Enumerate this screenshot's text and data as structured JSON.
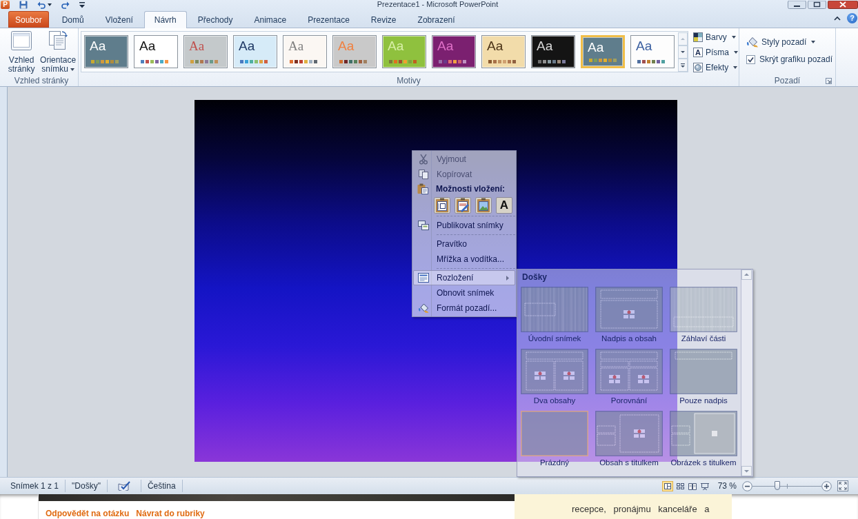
{
  "title_bar": {
    "logo": "P",
    "title": "Prezentace1 - Microsoft PowerPoint"
  },
  "tabs": [
    {
      "label": "Soubor",
      "kind": "file",
      "selected": false
    },
    {
      "label": "Domů",
      "kind": "tab",
      "selected": false
    },
    {
      "label": "Vložení",
      "kind": "tab",
      "selected": false
    },
    {
      "label": "Návrh",
      "kind": "tab",
      "selected": true
    },
    {
      "label": "Přechody",
      "kind": "tab",
      "selected": false
    },
    {
      "label": "Animace",
      "kind": "tab",
      "selected": false
    },
    {
      "label": "Prezentace",
      "kind": "tab",
      "selected": false
    },
    {
      "label": "Revize",
      "kind": "tab",
      "selected": false
    },
    {
      "label": "Zobrazení",
      "kind": "tab",
      "selected": false
    }
  ],
  "help": "?",
  "ribbon": {
    "groups": [
      {
        "kind": "page_setup",
        "label": "Vzhled stránky",
        "buttons": [
          {
            "kind": "page",
            "label": "Vzhled stránky",
            "dropdown": false
          },
          {
            "kind": "orientation",
            "label": "Orientace snímku",
            "dropdown": true
          }
        ]
      },
      {
        "kind": "themes",
        "label": "Motivy",
        "themes": [
          {
            "sample": "Aa",
            "color": "#5f7d8c",
            "selected": false
          },
          {
            "sample": "Aa",
            "color": "#ffffff",
            "selected": false
          },
          {
            "sample": "Aa",
            "color": "#c4c9cb",
            "selected": false
          },
          {
            "sample": "Aa",
            "color": "#d6ebf8",
            "selected": false
          },
          {
            "sample": "Aa",
            "color": "#fbf7f3",
            "selected": false
          },
          {
            "sample": "Aa",
            "color": "#c9c9c9",
            "selected": false
          },
          {
            "sample": "Aa",
            "color": "#8fc13e",
            "selected": false
          },
          {
            "sample": "Aa",
            "color": "#7b2070",
            "selected": false
          },
          {
            "sample": "Aa",
            "color": "#f2dcaa",
            "selected": false
          },
          {
            "sample": "Aa",
            "color": "#141414",
            "selected": false
          },
          {
            "sample": "Aa",
            "color": "#5f7d8c",
            "selected": true
          },
          {
            "sample": "Aa",
            "color": "#fdfdfd",
            "selected": false
          }
        ],
        "commands": [
          {
            "kind": "colors",
            "label": "Barvy",
            "dropdown": true
          },
          {
            "kind": "fonts",
            "glyph": "A",
            "label": "Písma",
            "dropdown": true
          },
          {
            "kind": "effects",
            "label": "Efekty",
            "dropdown": true
          }
        ]
      },
      {
        "kind": "background",
        "label": "Pozadí",
        "styles": {
          "label": "Styly pozadí",
          "dropdown": true
        },
        "hide_graphics": {
          "label": "Skrýt grafiku pozadí",
          "checked": true
        }
      }
    ]
  },
  "context_menu": {
    "items": [
      {
        "kind": "item",
        "label": "Vyjmout",
        "disabled": true,
        "selected": false
      },
      {
        "kind": "item",
        "label": "Kopírovat",
        "disabled": true,
        "selected": false
      },
      {
        "kind": "header",
        "label": "Možnosti vložení:"
      },
      {
        "kind": "paste_options",
        "options": [
          {
            "kind": "destination"
          },
          {
            "kind": "source"
          },
          {
            "kind": "picture"
          },
          {
            "kind": "text",
            "glyph": "A"
          }
        ]
      },
      {
        "kind": "separator"
      },
      {
        "kind": "item",
        "label": "Publikovat snímky",
        "disabled": false,
        "selected": false
      },
      {
        "kind": "separator"
      },
      {
        "kind": "item",
        "label": "Pravítko",
        "disabled": false,
        "selected": false
      },
      {
        "kind": "item",
        "label": "Mřížka a vodítka...",
        "disabled": false,
        "selected": false
      },
      {
        "kind": "separator"
      },
      {
        "kind": "submenu",
        "label": "Rozložení",
        "disabled": false,
        "selected": true
      },
      {
        "kind": "item",
        "label": "Obnovit snímek",
        "disabled": false,
        "selected": false
      },
      {
        "kind": "item",
        "label": "Formát pozadí...",
        "disabled": false,
        "selected": false
      }
    ]
  },
  "layout_gallery": {
    "title": "Došky",
    "layouts": [
      {
        "kind": "title",
        "label": "Úvodní snímek",
        "selected": false
      },
      {
        "kind": "title_content",
        "label": "Nadpis a obsah",
        "selected": false
      },
      {
        "kind": "section",
        "label": "Záhlaví části",
        "selected": false
      },
      {
        "kind": "two_content",
        "label": "Dva obsahy",
        "selected": false
      },
      {
        "kind": "comparison",
        "label": "Porovnání",
        "selected": false
      },
      {
        "kind": "title_only",
        "label": "Pouze nadpis",
        "selected": false
      },
      {
        "kind": "blank",
        "label": "Prázdný",
        "selected": true
      },
      {
        "kind": "content_caption",
        "label": "Obsah s titulkem",
        "selected": false
      },
      {
        "kind": "picture_caption",
        "label": "Obrázek s titulkem",
        "selected": false
      }
    ]
  },
  "status_bar": {
    "slide_info": "Snímek 1 z 1",
    "theme": "\"Došky\"",
    "language": "Čeština",
    "views": [
      {
        "kind": "normal",
        "selected": true
      },
      {
        "kind": "sorter",
        "selected": false
      },
      {
        "kind": "reading",
        "selected": false
      },
      {
        "kind": "slideshow",
        "selected": false
      }
    ],
    "zoom": "73 %",
    "zoom_slider": {
      "level": 0.36
    }
  },
  "web_page": {
    "links": [
      "Odpovědět na otázku",
      "Návrat do rubriky"
    ],
    "text": "recepce, pronájmu kanceláře a"
  }
}
